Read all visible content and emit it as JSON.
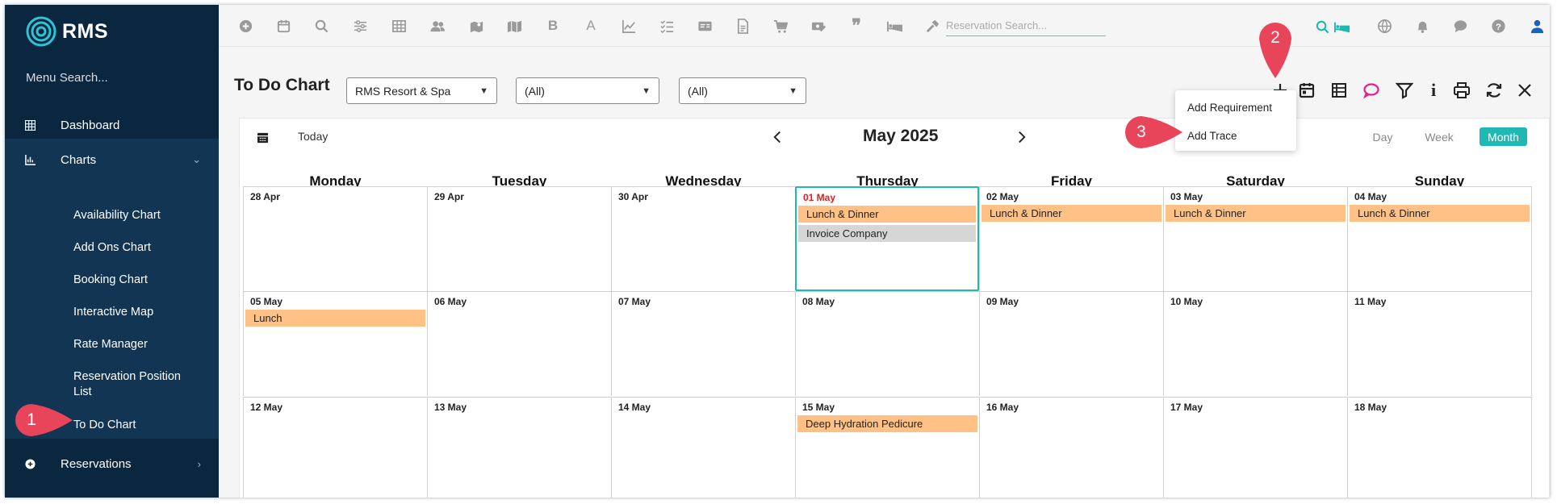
{
  "app": {
    "logo_text": "RMS"
  },
  "sidebar": {
    "menu_search_placeholder": "Menu Search...",
    "items": [
      {
        "label": "Dashboard",
        "icon": "table-icon"
      },
      {
        "label": "Charts",
        "icon": "chart-icon",
        "expanded": true
      },
      {
        "label": "Reservations",
        "icon": "plus-circle-icon"
      }
    ],
    "chart_subitems": [
      "Availability Chart",
      "Add Ons Chart",
      "Booking Chart",
      "Interactive Map",
      "Rate Manager",
      "Reservation Position List",
      "To Do Chart"
    ]
  },
  "header": {
    "icons": [
      "plus-circle-icon",
      "calendar-icon",
      "search-icon",
      "sliders-icon",
      "grid-icon",
      "users-icon",
      "map-marker-icon",
      "map-icon",
      "bold-icon",
      "font-icon",
      "line-chart-icon",
      "checklist-icon",
      "id-card-icon",
      "file-icon",
      "cart-icon",
      "money-icon",
      "quote-icon",
      "bed-icon",
      "hammer-icon"
    ],
    "reservation_search_placeholder": "Reservation Search...",
    "right_icons": [
      "globe-icon",
      "bell-icon",
      "chat-icon",
      "help-icon",
      "user-icon"
    ]
  },
  "toolbar": {
    "title": "To Do Chart",
    "property_select": "RMS Resort & Spa",
    "filter1_select": "(All)",
    "filter2_select": "(All)",
    "icons": [
      "add-icon",
      "calendar-icon",
      "list-icon",
      "comment-icon",
      "filter-icon",
      "info-icon",
      "print-icon",
      "refresh-icon",
      "close-icon"
    ]
  },
  "add_menu": {
    "items": [
      "Add Requirement",
      "Add Trace"
    ]
  },
  "callouts": [
    "1",
    "2",
    "3"
  ],
  "calendar": {
    "today_label": "Today",
    "month_title": "May 2025",
    "views": [
      "Day",
      "Week",
      "Month"
    ],
    "active_view": "Month",
    "day_names": [
      "Monday",
      "Tuesday",
      "Wednesday",
      "Thursday",
      "Friday",
      "Saturday",
      "Sunday"
    ],
    "weeks": [
      [
        {
          "date": "28 Apr",
          "events": []
        },
        {
          "date": "29 Apr",
          "events": []
        },
        {
          "date": "30 Apr",
          "events": []
        },
        {
          "date": "01 May",
          "today": true,
          "events": [
            {
              "title": "Lunch & Dinner",
              "type": "orange"
            },
            {
              "title": "Invoice Company",
              "type": "grey"
            }
          ]
        },
        {
          "date": "02 May",
          "events": [
            {
              "title": "Lunch & Dinner",
              "type": "orange"
            }
          ]
        },
        {
          "date": "03 May",
          "events": [
            {
              "title": "Lunch & Dinner",
              "type": "orange"
            }
          ]
        },
        {
          "date": "04 May",
          "events": [
            {
              "title": "Lunch & Dinner",
              "type": "orange"
            }
          ]
        }
      ],
      [
        {
          "date": "05 May",
          "events": [
            {
              "title": "Lunch",
              "type": "orange"
            }
          ]
        },
        {
          "date": "06 May",
          "events": []
        },
        {
          "date": "07 May",
          "events": []
        },
        {
          "date": "08 May",
          "events": []
        },
        {
          "date": "09 May",
          "events": []
        },
        {
          "date": "10 May",
          "events": []
        },
        {
          "date": "11 May",
          "events": []
        }
      ],
      [
        {
          "date": "12 May",
          "events": []
        },
        {
          "date": "13 May",
          "events": []
        },
        {
          "date": "14 May",
          "events": []
        },
        {
          "date": "15 May",
          "events": [
            {
              "title": "Deep Hydration Pedicure",
              "type": "orange"
            }
          ]
        },
        {
          "date": "16 May",
          "events": []
        },
        {
          "date": "17 May",
          "events": []
        },
        {
          "date": "18 May",
          "events": []
        }
      ]
    ]
  },
  "colors": {
    "sidebar_bg": "#0b2740",
    "sidebar_active": "#123554",
    "accent": "#20b8b2",
    "event_orange": "#ffc185",
    "event_grey": "#d6d6d6",
    "today_date": "#e02020",
    "callout": "#e8445a"
  }
}
